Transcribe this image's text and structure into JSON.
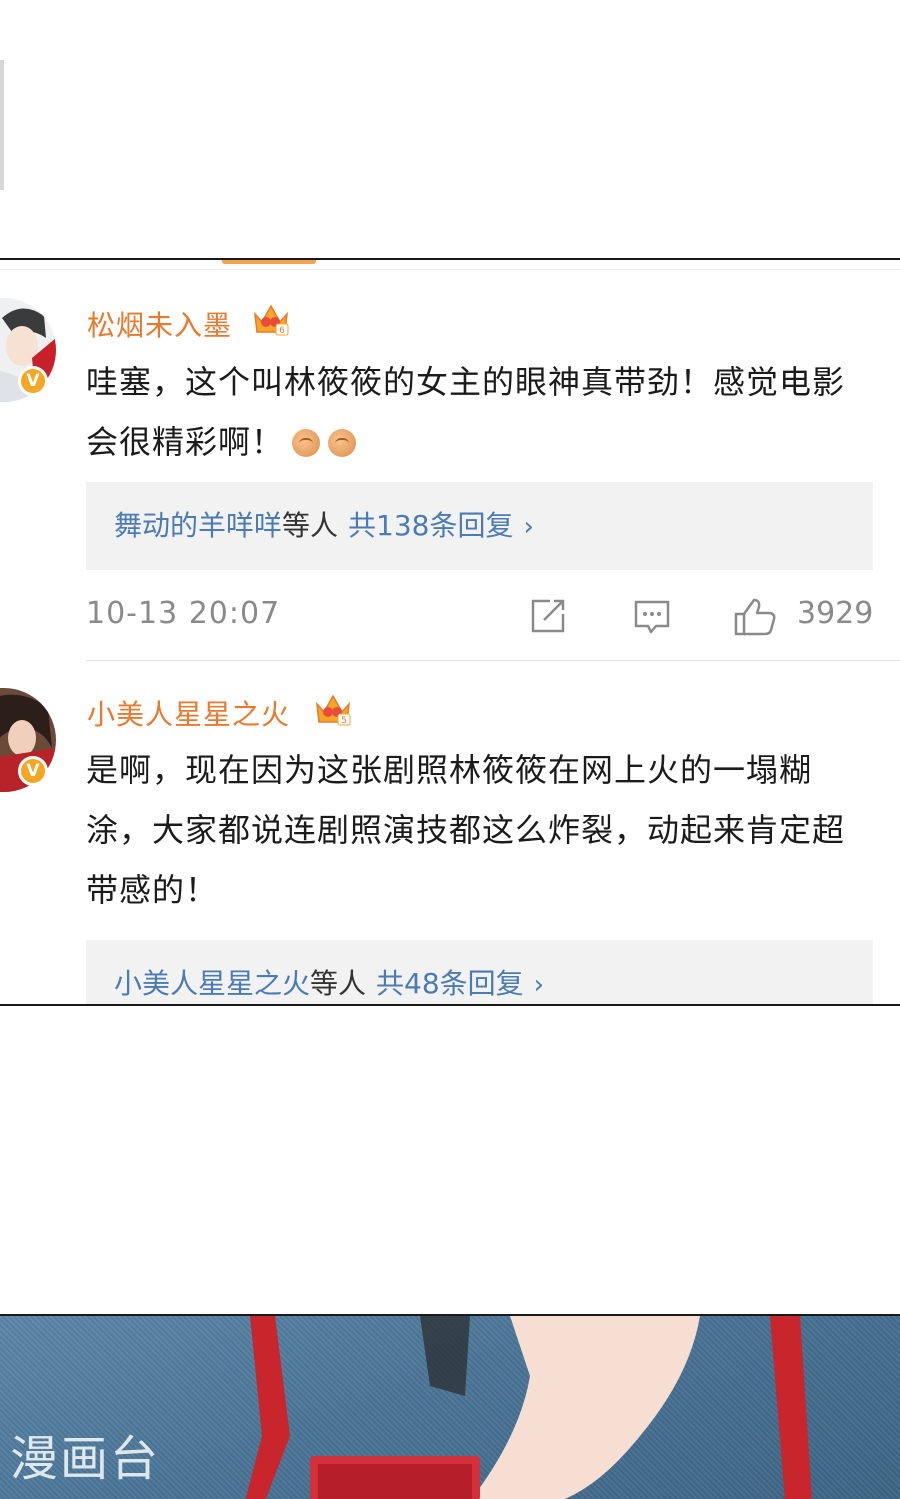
{
  "comments": [
    {
      "username": "松烟未入墨",
      "level_badge": "6",
      "verified_badge": "V",
      "text": "哇塞，这个叫林筱筱的女主的眼神真带劲！感觉电影会很精彩啊！",
      "emojis": [
        "fist-icon",
        "fist-icon"
      ],
      "reply_preview": {
        "who": "舞动的羊咩咩",
        "rest": "等人",
        "count": "共138条回复",
        "chevron": "›"
      },
      "timestamp": "10-13 20:07",
      "likes": "3929"
    },
    {
      "username": "小美人星星之火",
      "level_badge": "5",
      "verified_badge": "V",
      "text": "是啊，现在因为这张剧照林筱筱在网上火的一塌糊涂，大家都说连剧照演技都这么炸裂，动起来肯定超带感的！",
      "reply_preview": {
        "who": "小美人星星之火",
        "rest": "等人",
        "count": "共48条回复",
        "chevron": "›"
      }
    }
  ],
  "watermark": "漫画台",
  "colors": {
    "username": "#e8792f",
    "link": "#4a7bb7",
    "meta": "#8a8a8a",
    "badge": "#f5a623"
  }
}
